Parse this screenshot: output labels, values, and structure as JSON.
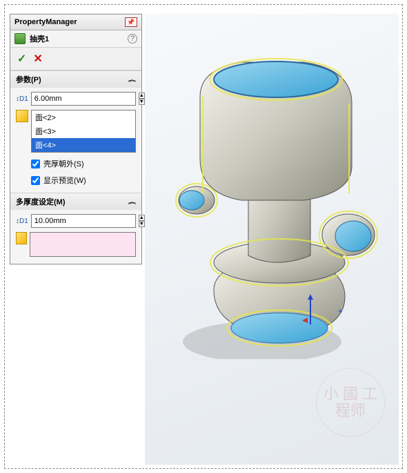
{
  "header": {
    "title": "PropertyManager"
  },
  "feature": {
    "name": "抽壳1",
    "help": "?"
  },
  "confirm": {
    "ok": "✓",
    "cancel": "✕"
  },
  "params": {
    "title": "参数(P)",
    "thickness": "6.00mm",
    "faces": [
      "面<2>",
      "面<3>",
      "面<4>"
    ],
    "selected_index": 2,
    "shell_outward_label": "壳厚朝外(S)",
    "shell_outward": true,
    "show_preview_label": "显示预览(W)",
    "show_preview": true
  },
  "multi": {
    "title": "多厚度设定(M)",
    "thickness": "10.00mm"
  },
  "watermark": "小 國\n工程师",
  "icons": {
    "dim": "↕D1",
    "chev": "︽"
  }
}
